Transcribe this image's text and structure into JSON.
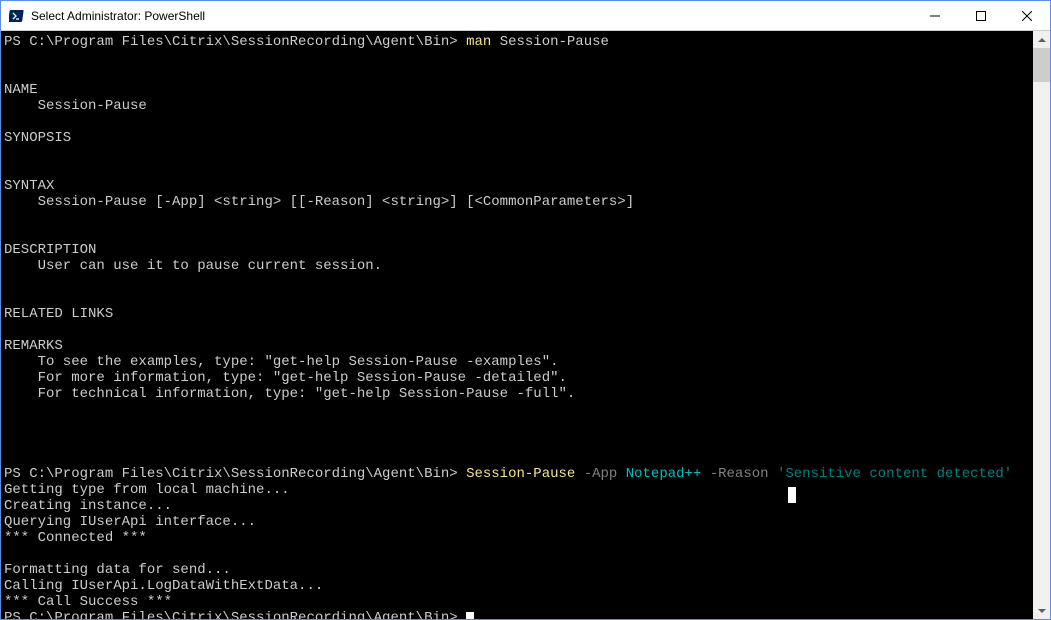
{
  "titlebar": {
    "title": "Select Administrator: PowerShell"
  },
  "terminal": {
    "prompt": "PS C:\\Program Files\\Citrix\\SessionRecording\\Agent\\Bin> ",
    "cmd1_keyword": "man",
    "cmd1_arg": " Session-Pause",
    "man_name_hdr": "NAME",
    "man_name_val": "    Session-Pause",
    "man_syn_hdr": "SYNOPSIS",
    "man_syntax_hdr": "SYNTAX",
    "man_syntax_val": "    Session-Pause [-App] <string> [[-Reason] <string>] [<CommonParameters>]",
    "man_desc_hdr": "DESCRIPTION",
    "man_desc_val": "    User can use it to pause current session.",
    "man_rel_hdr": "RELATED LINKS",
    "man_rem_hdr": "REMARKS",
    "man_rem_l1": "    To see the examples, type: \"get-help Session-Pause -examples\".",
    "man_rem_l2": "    For more information, type: \"get-help Session-Pause -detailed\".",
    "man_rem_l3": "    For technical information, type: \"get-help Session-Pause -full\".",
    "cmd2_keyword": "Session-Pause",
    "cmd2_p1": " -App",
    "cmd2_a1": " Notepad++",
    "cmd2_p2": " -Reason",
    "cmd2_a2": " 'Sensitive content detected'",
    "out_l1": "Getting type from local machine...",
    "out_l2": "Creating instance...",
    "out_l3": "Querying IUserApi interface...",
    "out_l4": "*** Connected ***",
    "out_l5": "Formatting data for send...",
    "out_l6": "Calling IUserApi.LogDataWithExtData...",
    "out_l7": "*** Call Success ***"
  }
}
